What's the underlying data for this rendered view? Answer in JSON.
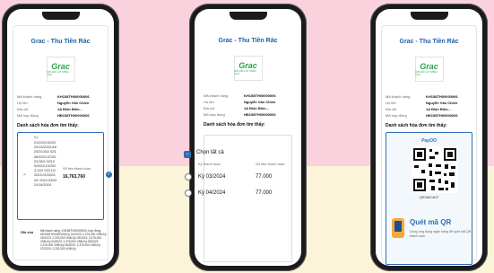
{
  "screens": [
    {
      "title": "Grac - Thu Tiền Rác",
      "logo_word": "Grac",
      "logo_tag": "ĐỔI RÁC LẤY NHIỀU QUÀ",
      "info": [
        {
          "k": "Mã khách hàng",
          "v": "KH158TH00000006"
        },
        {
          "k": "Họ tên",
          "v": "Nguyễn Văn Chiến"
        },
        {
          "k": "Địa chỉ",
          "v": "1A Điện Biên..."
        },
        {
          "k": "Mã hợp đồng",
          "v": "HĐ158TH00000006"
        }
      ],
      "list_title": "Danh sách hóa đơn tìm thấy:",
      "period_label": "Kỳ",
      "periods": "01/2023,02/20 23,03/2023,04/2023,05/2 023,06/2023,07/2023,08/2 023,09/2023,10/2023,11/2 023,12/2023,01/2024,02/ 2024,03/2024,04/2024",
      "amount_label": "Số tiền thanh toán",
      "amount": "16,763,760",
      "note_label": "Ghi chú",
      "note": "Mã khách hàng: KH158TH00000006, hợp đồng: HĐ158TH00000006,Kỳ 01/2023: 2,376,000 VNĐ;Kỳ 02/2023: 2,376,000 VNĐ;Kỳ 03/2023: 2,376,000 VNĐ;Kỳ 04/2023: 2,376,000 VNĐ;Kỳ 05/2023: 2,376,000 VNĐ;Kỳ 06/2023: 2,376,000 VNĐ;Kỳ 07/2023: 2,232,000 VNĐ;Kỳ"
    },
    {
      "title": "Grac - Thu Tiền Rác",
      "logo_word": "Grac",
      "logo_tag": "ĐỔI RÁC LẤY NHIỀU QUÀ",
      "info": [
        {
          "k": "Mã khách hàng",
          "v": "KH158TH00000006"
        },
        {
          "k": "Họ tên",
          "v": "Nguyễn Văn Chiến"
        },
        {
          "k": "Địa chỉ",
          "v": "1A Điện Biên..."
        },
        {
          "k": "Mã hợp đồng",
          "v": "HĐ158TH00000006"
        }
      ],
      "list_title": "Danh sách hóa đơn tìm thấy:",
      "select_all": "Chọn tất cả",
      "col_period": "Kỳ thanh toán",
      "col_amount": "Số tiền thanh toán",
      "rows": [
        {
          "period": "Kỳ 03/2024",
          "amount": "77.000"
        },
        {
          "period": "Kỳ 04/2024",
          "amount": "77.000"
        }
      ]
    },
    {
      "title": "Grac - Thu Tiền Rác",
      "logo_word": "Grac",
      "logo_tag": "ĐỔI RÁC LẤY NHIỀU QUÀ",
      "info": [
        {
          "k": "Mã khách hàng",
          "v": "KH158TH00000006"
        },
        {
          "k": "Họ tên",
          "v": "Nguyễn Văn Chiến"
        },
        {
          "k": "Địa chỉ",
          "v": "1A Điện Biên..."
        },
        {
          "k": "Mã hợp đồng",
          "v": "HĐ158TH00000006"
        }
      ],
      "list_title": "Danh sách hóa đơn tìm thấy:",
      "pay_brand": "PayOO",
      "qr_code_label": "QR2MC4KF",
      "scan_title": "Quét mã QR",
      "scan_desc": "Dùng ứng dụng ngân hàng để quét mã QR thanh toán."
    }
  ],
  "colors": {
    "accent": "#2f6db5",
    "brand_green": "#2aa24a",
    "bg_pink": "#f9d2de",
    "bg_cream": "#fcf4d8"
  }
}
